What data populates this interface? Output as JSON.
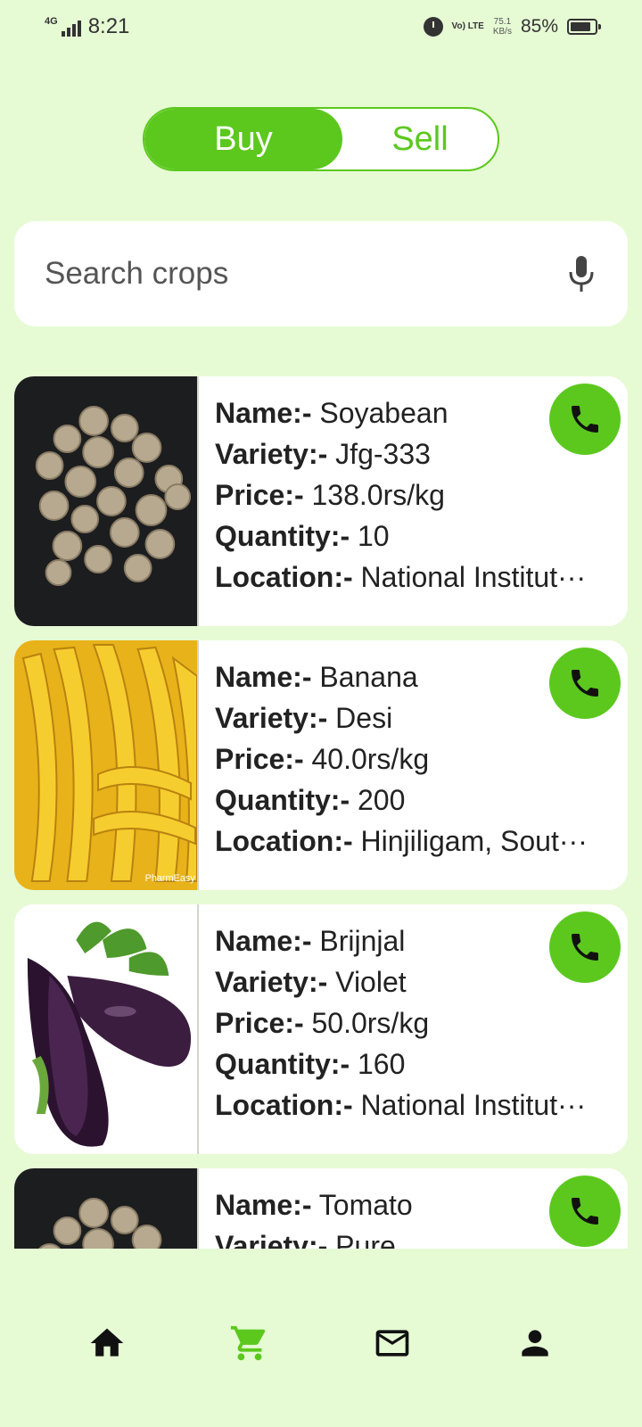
{
  "status_bar": {
    "network": "4G",
    "time": "8:21",
    "volte": "Vo) LTE",
    "speed_value": "75.1",
    "speed_unit": "KB/s",
    "battery_percent": "85%",
    "battery_level": 0.85
  },
  "toggle": {
    "buy_label": "Buy",
    "sell_label": "Sell",
    "selected": "Buy"
  },
  "search": {
    "placeholder": "Search crops",
    "value": ""
  },
  "labels": {
    "name": "Name:-",
    "variety": "Variety:-",
    "price": "Price:-",
    "quantity": "Quantity:-",
    "location": "Location:-"
  },
  "listings": [
    {
      "image": "soyabean-image",
      "name": "Soyabean",
      "variety": "Jfg-333",
      "price": "138.0rs/kg",
      "quantity": "10",
      "location": "National Institut···"
    },
    {
      "image": "banana-image",
      "name": "Banana",
      "variety": "Desi",
      "price": "40.0rs/kg",
      "quantity": "200",
      "location": "Hinjiligam, Sout···",
      "watermark": "PharmEasy"
    },
    {
      "image": "brinjal-image",
      "name": "Brijnjal",
      "variety": "Violet",
      "price": "50.0rs/kg",
      "quantity": "160",
      "location": "National Institut···"
    },
    {
      "image": "soyabean-image",
      "name": "Tomato",
      "variety": "Pure",
      "price": "",
      "quantity": "",
      "location": ""
    }
  ],
  "bottom_nav": [
    {
      "icon": "home-icon",
      "active": false
    },
    {
      "icon": "cart-icon",
      "active": true
    },
    {
      "icon": "mail-icon",
      "active": false
    },
    {
      "icon": "profile-icon",
      "active": false
    }
  ],
  "colors": {
    "background": "#e6fbd4",
    "accent": "#5cc81e",
    "card": "#ffffff",
    "nav_inactive": "#111111"
  }
}
